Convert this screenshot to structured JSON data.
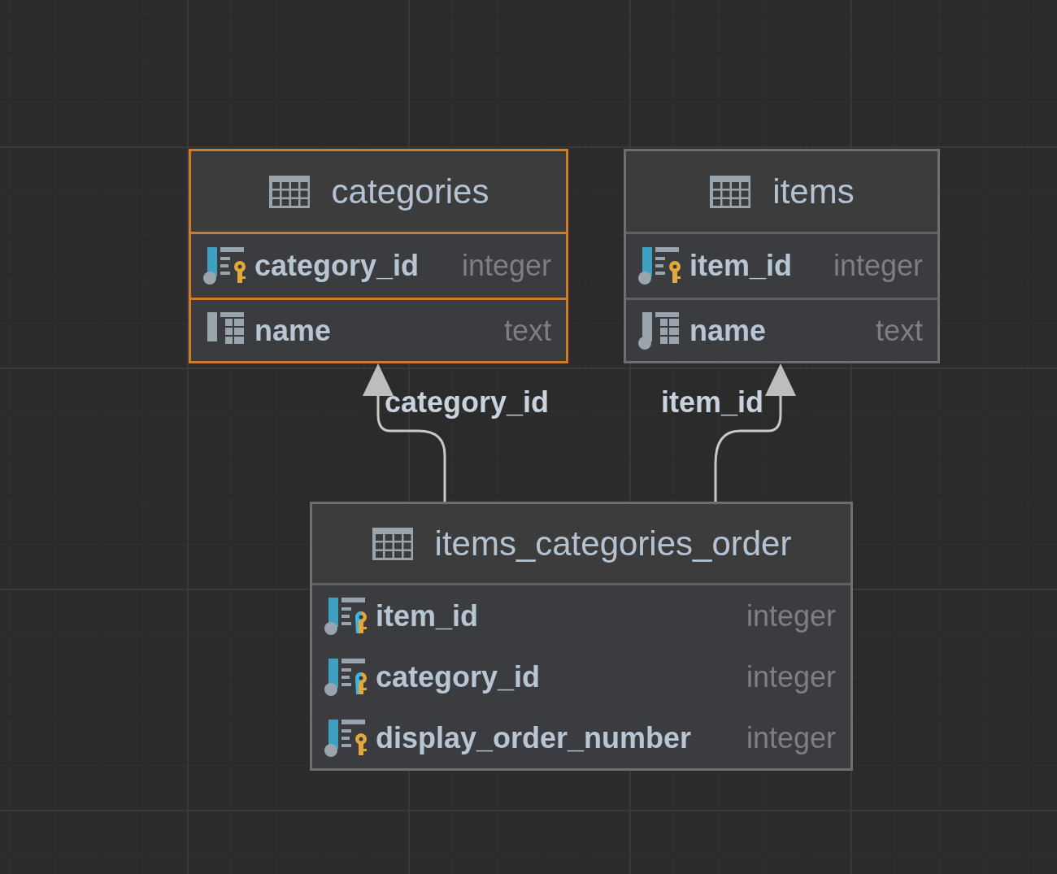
{
  "tables": [
    {
      "name": "categories",
      "selected": true,
      "columns": [
        {
          "name": "category_id",
          "type": "integer",
          "kind": "primary_key"
        },
        {
          "name": "name",
          "type": "text",
          "kind": "column"
        }
      ]
    },
    {
      "name": "items",
      "selected": false,
      "columns": [
        {
          "name": "item_id",
          "type": "integer",
          "kind": "primary_key"
        },
        {
          "name": "name",
          "type": "text",
          "kind": "column_not_null"
        }
      ]
    },
    {
      "name": "items_categories_order",
      "selected": false,
      "columns": [
        {
          "name": "item_id",
          "type": "integer",
          "kind": "primary_foreign_key"
        },
        {
          "name": "category_id",
          "type": "integer",
          "kind": "primary_foreign_key"
        },
        {
          "name": "display_order_number",
          "type": "integer",
          "kind": "primary_key"
        }
      ]
    }
  ],
  "relations": [
    {
      "label": "category_id"
    },
    {
      "label": "item_id"
    }
  ]
}
